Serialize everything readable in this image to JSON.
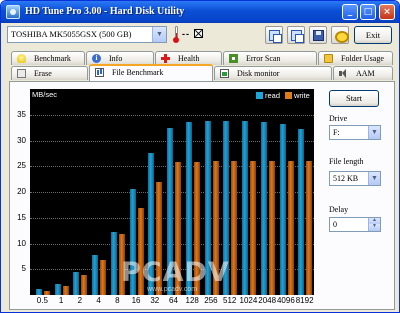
{
  "window": {
    "title": "HD Tune Pro 3.00 - Hard Disk Utility",
    "buttons": {
      "minimize": "_",
      "maximize": "□",
      "close": "×"
    }
  },
  "toolbar": {
    "drive": "TOSHIBA MK5055GSX (500 GB)",
    "temperature": "--",
    "exit_label": "Exit",
    "icons": [
      "copy-text-icon",
      "copy-screenshot-icon",
      "save-icon",
      "options-icon",
      "download-icon"
    ]
  },
  "tabs": {
    "row1": [
      "Benchmark",
      "Info",
      "Health",
      "Error Scan",
      "Folder Usage"
    ],
    "row2": [
      "Erase",
      "File Benchmark",
      "Disk monitor",
      "AAM"
    ],
    "active": "File Benchmark"
  },
  "chart_data": {
    "type": "bar",
    "ylabel": "MB/sec",
    "ylim": [
      0,
      40
    ],
    "yticks": [
      5,
      10,
      15,
      20,
      25,
      30,
      35
    ],
    "categories": [
      "0.5",
      "1",
      "2",
      "4",
      "8",
      "16",
      "32",
      "64",
      "128",
      "256",
      "512",
      "1024",
      "2048",
      "4096",
      "8192"
    ],
    "series": [
      {
        "name": "read",
        "color": "#1ea6dc",
        "values": [
          1.2,
          2.2,
          4.5,
          7.7,
          12.2,
          20.5,
          27.5,
          32.5,
          33.5,
          33.7,
          33.7,
          33.7,
          33.5,
          33.2,
          32.3
        ]
      },
      {
        "name": "write",
        "color": "#e07b1a",
        "values": [
          0.8,
          1.8,
          3.8,
          6.8,
          11.8,
          16.8,
          22.0,
          25.8,
          25.9,
          26.0,
          26.0,
          26.0,
          26.0,
          26.0,
          26.0
        ]
      }
    ],
    "legend": "top-right",
    "grid": true
  },
  "controls": {
    "start_label": "Start",
    "drive_label": "Drive",
    "drive_value": "F:",
    "file_length_label": "File length",
    "file_length_value": "512 KB",
    "delay_label": "Delay",
    "delay_value": "0"
  },
  "watermark": {
    "text": "PCADV",
    "url": "www.pcadv.com"
  }
}
